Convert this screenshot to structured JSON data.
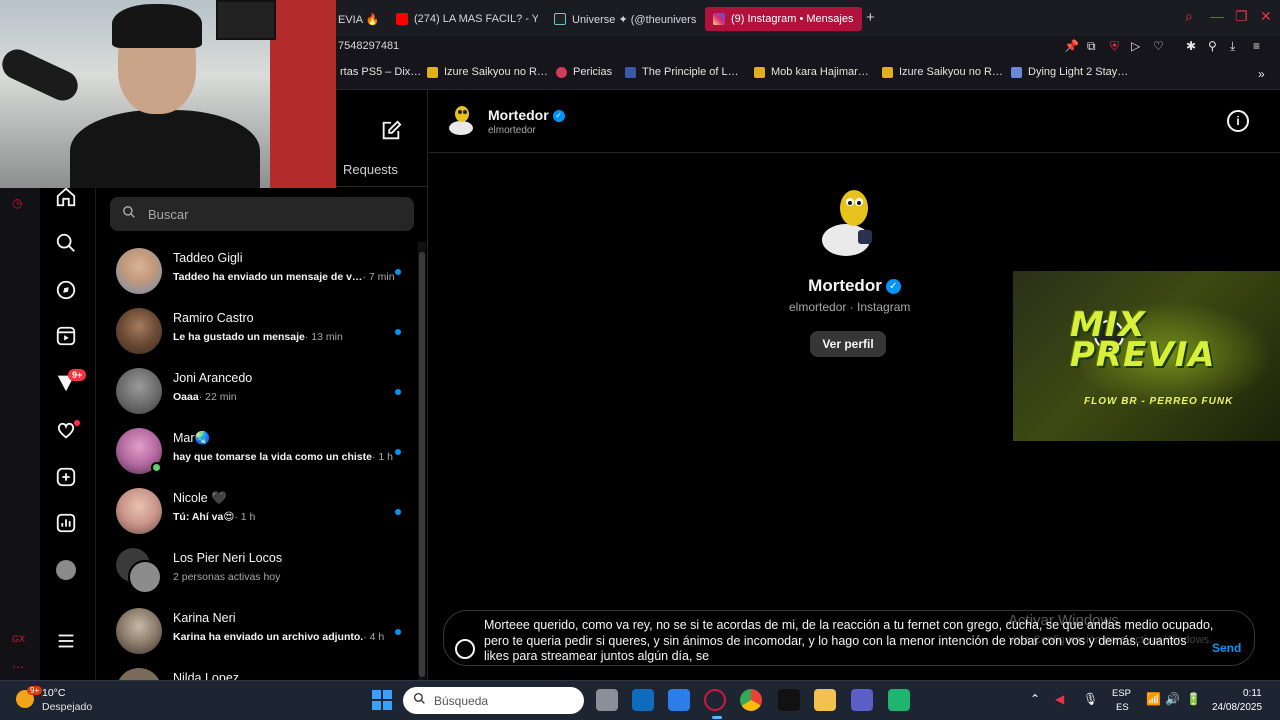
{
  "browser": {
    "tabs": [
      {
        "label": "EVIA 🔥",
        "icon": "opera-icon"
      },
      {
        "label": "(274) LA MAS FACIL? - Yo",
        "icon": "youtube-icon"
      },
      {
        "label": "Universe ✦ (@theunivers",
        "icon": "tiktok-icon"
      },
      {
        "label": "(9) Instagram • Mensajes",
        "icon": "instagram-icon",
        "active": true
      }
    ],
    "address": "7548297481",
    "bookmarks": [
      "rtas PS5 – Dix…",
      "Izure Saikyou no R…",
      "Pericias",
      "The Principle of L…",
      "Mob kara Hajimar…",
      "Izure Saikyou no R…",
      "Dying Light 2 Stay…"
    ]
  },
  "inbox": {
    "requests_label": "Requests",
    "search_placeholder": "Buscar",
    "conversations": [
      {
        "name": "Taddeo Gigli",
        "preview": "Taddeo ha enviado un mensaje de v…",
        "time": " · 7 min",
        "unread": true
      },
      {
        "name": "Ramiro Castro",
        "preview": "Le ha gustado un mensaje",
        "time": " · 13 min",
        "unread": true
      },
      {
        "name": "Joni Arancedo",
        "preview": "Oaaa",
        "time": " · 22 min",
        "unread": true
      },
      {
        "name": "Mar🌏",
        "preview": "hay que tomarse la vida como un chiste",
        "time": " · 1 h",
        "unread": true,
        "online": true
      },
      {
        "name": "Nicole 🖤",
        "preview": "Tú: Ahí va😍",
        "time": " · 1 h",
        "unread": true
      },
      {
        "name": "Los Pier Neri Locos",
        "preview": "2 personas activas hoy",
        "time": "",
        "unread": false
      },
      {
        "name": "Karina Neri",
        "preview": "Karina ha enviado un archivo adjunto.",
        "time": " · 4 h",
        "unread": true
      },
      {
        "name": "Nilda Lopez",
        "preview": "",
        "time": "",
        "unread": false
      }
    ],
    "nav_badge": "9+"
  },
  "chat": {
    "name": "Mortedor",
    "username": "elmortedor",
    "profile_name": "Mortedor",
    "profile_sub": "elmortedor · Instagram",
    "view_profile": "Ver perfil",
    "message_line1": "Morteee querido, como va rey, no se si te acordas de mi, de la reacción a tu fernet con grego, cucha, se que andas medio ocupado,",
    "message_line2": "pero te queria pedir si queres, y sin ánimos de incomodar, y lo hago con la menor intención de robar con vos y demás, cuantos",
    "message_line3": "likes para streamear juntos algún día, se",
    "send": "Send",
    "watermark_title": "Activar Windows",
    "watermark_sub": "Ve a Configuración para activar Windows."
  },
  "promo": {
    "title": "MIX PREVIA",
    "subtitle": "FLOW BR - PERREO FUNK"
  },
  "taskbar": {
    "temp": "10°C",
    "weather": "Despejado",
    "weather_badge": "9+",
    "search_placeholder": "Búsqueda",
    "lang1": "ESP",
    "lang2": "ES",
    "time": "0:11",
    "date": "24/08/2025"
  },
  "colors": {
    "accent_blue": "#0095f6",
    "opera_red": "#d4153f",
    "tab_active": "#b0123c"
  }
}
